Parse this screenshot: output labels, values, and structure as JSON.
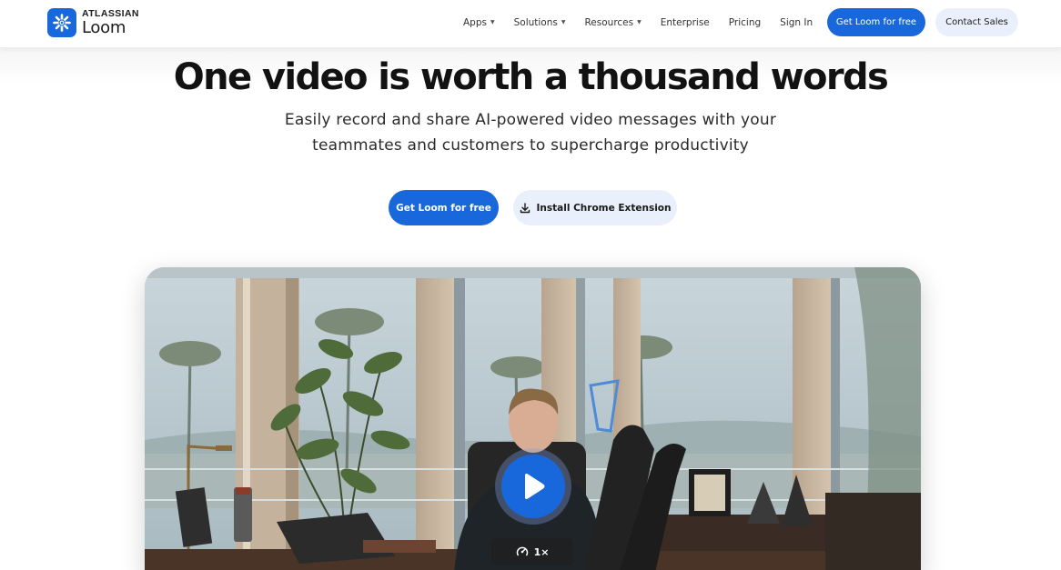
{
  "header": {
    "logo": {
      "brand": "ATLASSIAN",
      "product": "Loom",
      "icon": "loom-starburst-icon"
    },
    "nav": [
      {
        "label": "Apps",
        "has_dropdown": true
      },
      {
        "label": "Solutions",
        "has_dropdown": true
      },
      {
        "label": "Resources",
        "has_dropdown": true
      },
      {
        "label": "Enterprise",
        "has_dropdown": false
      },
      {
        "label": "Pricing",
        "has_dropdown": false
      },
      {
        "label": "Sign In",
        "has_dropdown": false
      }
    ],
    "primary_cta": "Get Loom for free",
    "secondary_cta": "Contact Sales",
    "dropdown_icon": "caret-down-icon"
  },
  "hero": {
    "title": "One video is worth a thousand words",
    "subtitle_line1": "Easily record and share AI-powered video messages with your",
    "subtitle_line2": "teammates and customers to supercharge productivity",
    "primary_cta": "Get Loom for free",
    "secondary_cta": "Install Chrome Extension",
    "secondary_cta_icon": "download-icon"
  },
  "video": {
    "play_icon": "play-icon",
    "speed_icon": "playback-speed-icon",
    "speed": "1×"
  },
  "colors": {
    "accent": "#1868db",
    "secondary_button_bg": "#e9f0fc",
    "text": "#121212"
  }
}
